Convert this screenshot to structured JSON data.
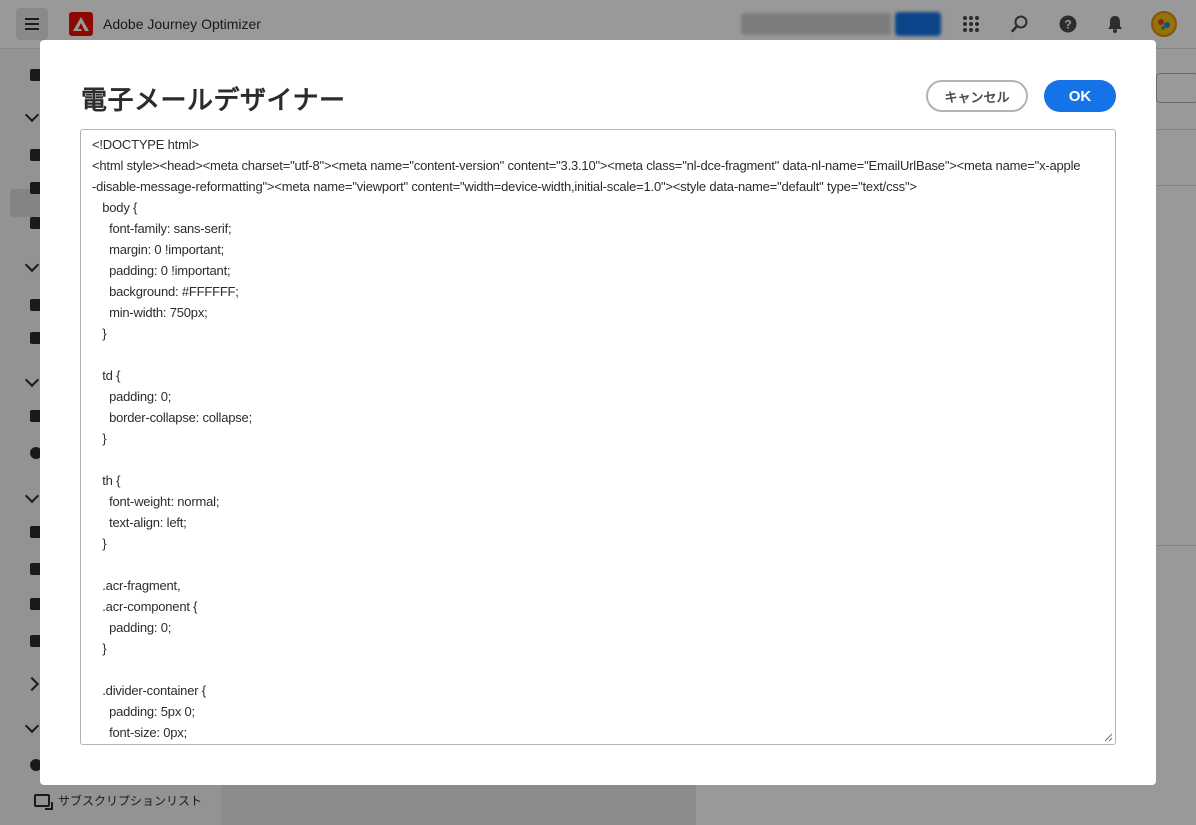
{
  "topbar": {
    "app_name": "Adobe Journey Optimizer",
    "menu_icon": "hamburger-icon",
    "logo_icon": "adobe-logo-icon",
    "icons": [
      "apps-grid-icon",
      "search-icon",
      "help-icon",
      "bell-icon",
      "avatar-icon"
    ]
  },
  "leftnav": {
    "bottom_item_label": "サブスクリプションリスト"
  },
  "dialog": {
    "title": "電子メールデザイナー",
    "cancel_label": "キャンセル",
    "ok_label": "OK",
    "code": "<!DOCTYPE html>\n<html style><head><meta charset=\"utf-8\"><meta name=\"content-version\" content=\"3.3.10\"><meta class=\"nl-dce-fragment\" data-nl-name=\"EmailUrlBase\"><meta name=\"x-apple-disable-message-reformatting\"><meta name=\"viewport\" content=\"width=device-width,initial-scale=1.0\"><style data-name=\"default\" type=\"text/css\">\n   body {\n     font-family: sans-serif;\n     margin: 0 !important;\n     padding: 0 !important;\n     background: #FFFFFF;\n     min-width: 750px;\n   }\n\n   td {\n     padding: 0;\n     border-collapse: collapse;\n   }\n\n   th {\n     font-weight: normal;\n     text-align: left;\n   }\n\n   .acr-fragment,\n   .acr-component {\n     padding: 0;\n   }\n\n   .divider-container {\n     padding: 5px 0;\n     font-size: 0px;"
  },
  "colors": {
    "accent": "#1473e6",
    "brand": "#eb1000",
    "overlay": "rgba(0,0,0,0.4)"
  }
}
